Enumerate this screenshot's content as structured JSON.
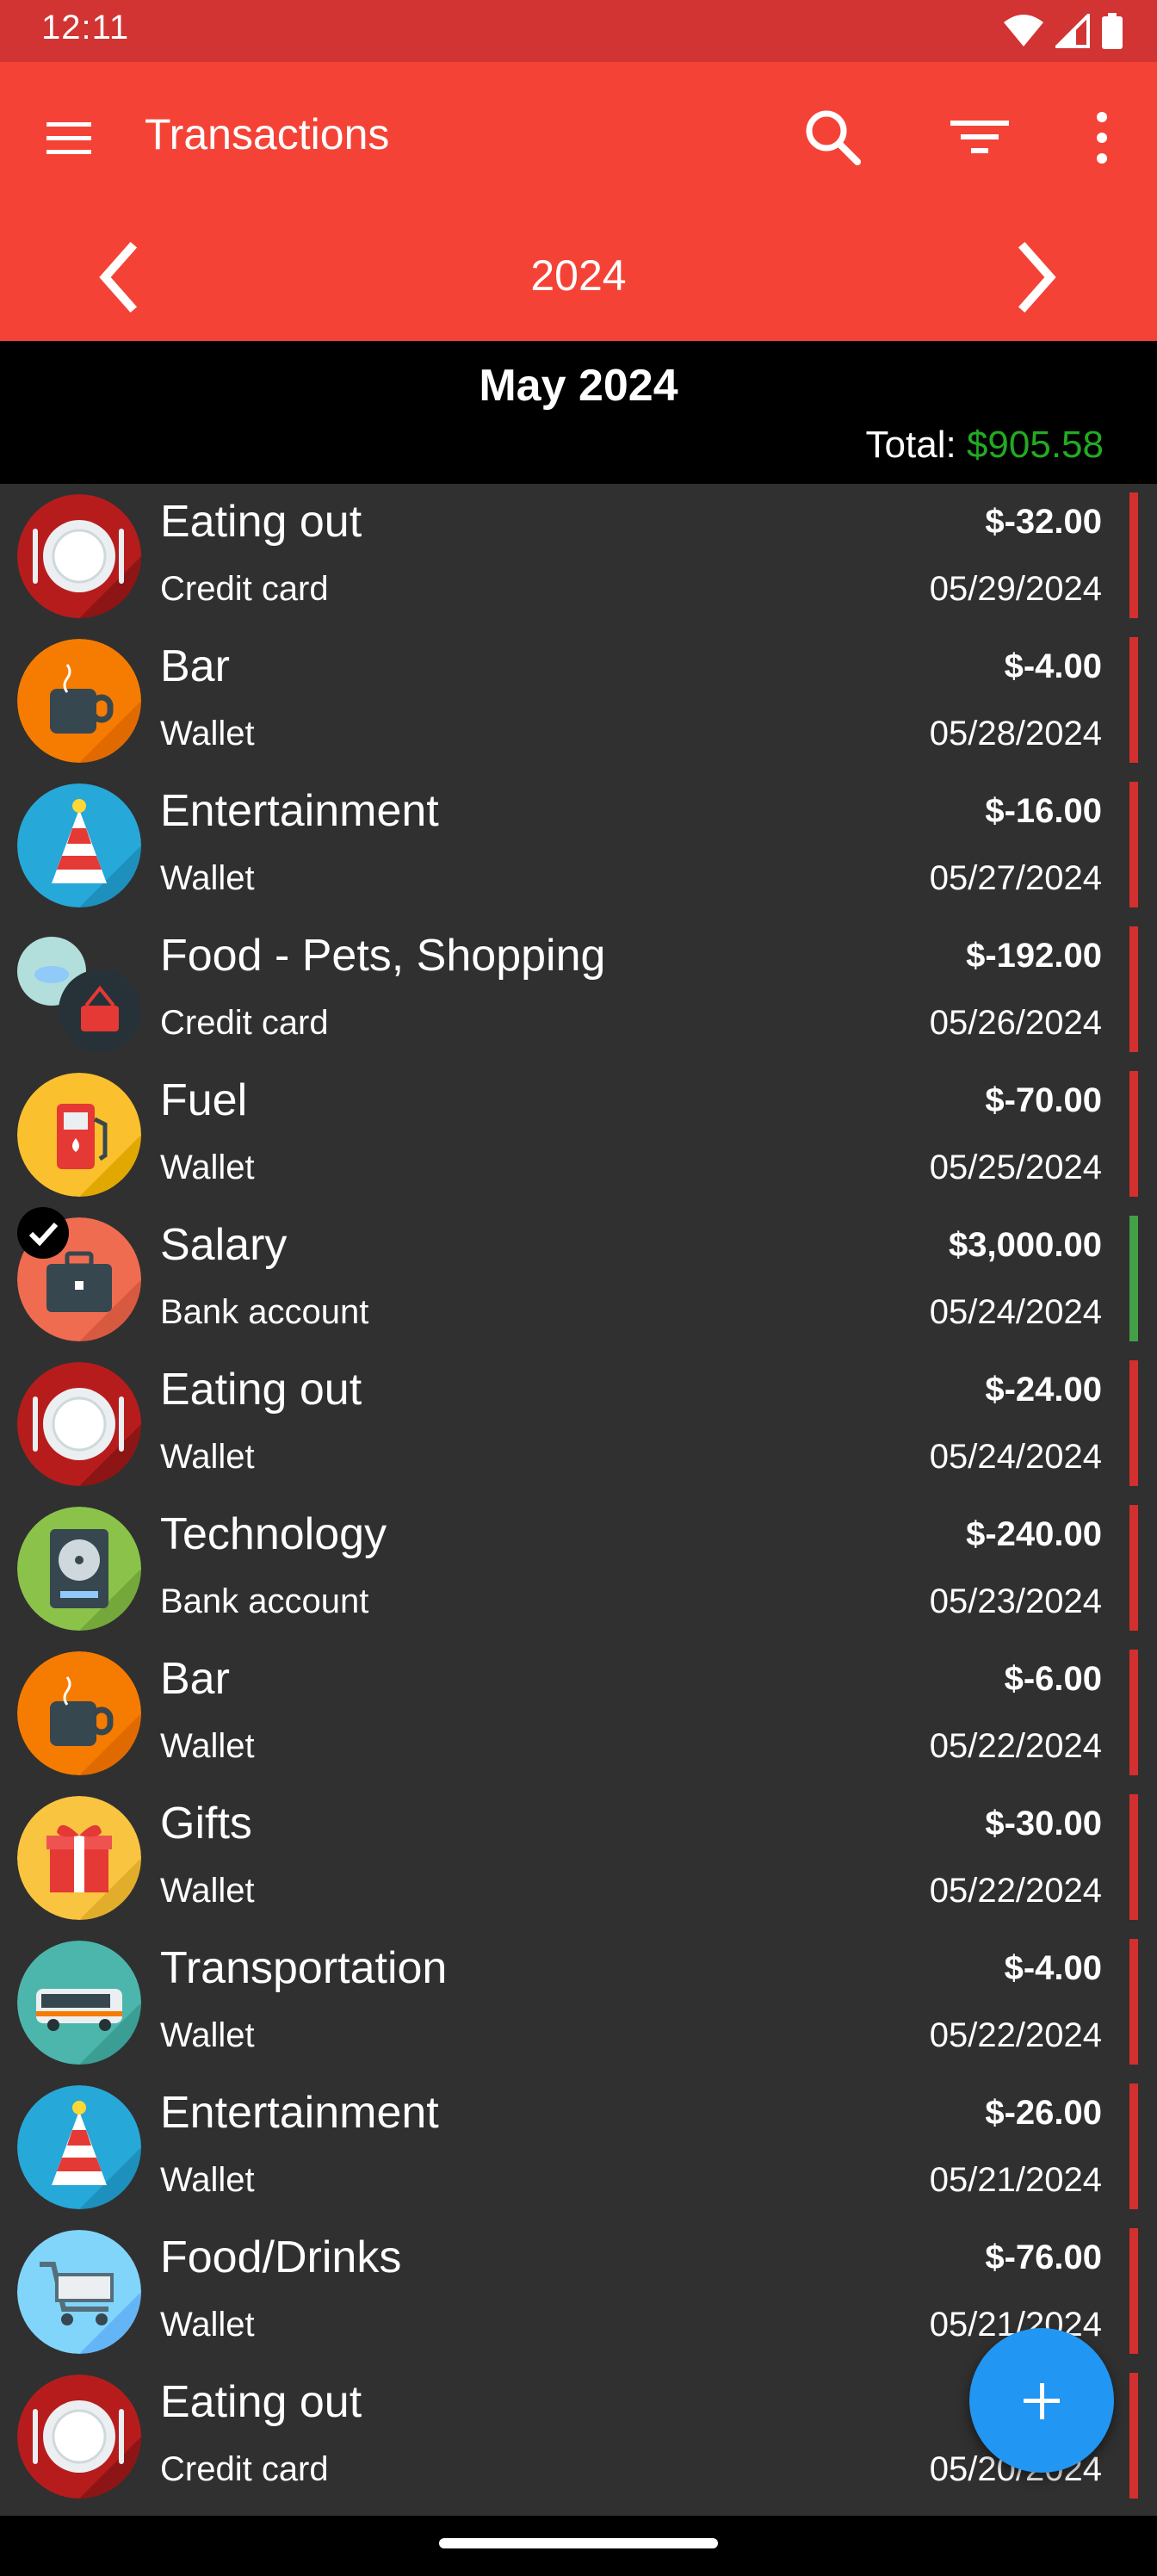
{
  "status": {
    "time": "12:11"
  },
  "toolbar": {
    "title": "Transactions",
    "year": "2024"
  },
  "month": {
    "title": "May 2024",
    "total_label": "Total:",
    "total_value": "$905.58",
    "total_color": "#22aa22"
  },
  "colors": {
    "expense": "#d32f2f",
    "income": "#43a047",
    "fab": "#2196f3",
    "toolbar": "#f44336"
  },
  "transactions": [
    {
      "category": "Eating out",
      "account": "Credit card",
      "amount": "$-32.00",
      "date": "05/29/2024",
      "type": "expense",
      "icon": "plate-icon"
    },
    {
      "category": "Bar",
      "account": "Wallet",
      "amount": "$-4.00",
      "date": "05/28/2024",
      "type": "expense",
      "icon": "coffee-cup-icon"
    },
    {
      "category": "Entertainment",
      "account": "Wallet",
      "amount": "$-16.00",
      "date": "05/27/2024",
      "type": "expense",
      "icon": "party-hat-icon"
    },
    {
      "category": "Food - Pets, Shopping",
      "account": "Credit card",
      "amount": "$-192.00",
      "date": "05/26/2024",
      "type": "expense",
      "icon": "pet-bowl-basket-icon"
    },
    {
      "category": "Fuel",
      "account": "Wallet",
      "amount": "$-70.00",
      "date": "05/25/2024",
      "type": "expense",
      "icon": "fuel-pump-icon"
    },
    {
      "category": "Salary",
      "account": "Bank account",
      "amount": "$3,000.00",
      "date": "05/24/2024",
      "type": "income",
      "icon": "briefcase-icon"
    },
    {
      "category": "Eating out",
      "account": "Wallet",
      "amount": "$-24.00",
      "date": "05/24/2024",
      "type": "expense",
      "icon": "plate-icon"
    },
    {
      "category": "Technology",
      "account": "Bank account",
      "amount": "$-240.00",
      "date": "05/23/2024",
      "type": "expense",
      "icon": "hard-drive-icon"
    },
    {
      "category": "Bar",
      "account": "Wallet",
      "amount": "$-6.00",
      "date": "05/22/2024",
      "type": "expense",
      "icon": "coffee-cup-icon"
    },
    {
      "category": "Gifts",
      "account": "Wallet",
      "amount": "$-30.00",
      "date": "05/22/2024",
      "type": "expense",
      "icon": "gift-icon"
    },
    {
      "category": "Transportation",
      "account": "Wallet",
      "amount": "$-4.00",
      "date": "05/22/2024",
      "type": "expense",
      "icon": "bus-icon"
    },
    {
      "category": "Entertainment",
      "account": "Wallet",
      "amount": "$-26.00",
      "date": "05/21/2024",
      "type": "expense",
      "icon": "party-hat-icon"
    },
    {
      "category": "Food/Drinks",
      "account": "Wallet",
      "amount": "$-76.00",
      "date": "05/21/2024",
      "type": "expense",
      "icon": "shopping-cart-icon"
    },
    {
      "category": "Eating out",
      "account": "Credit card",
      "amount": "",
      "date": "05/20/2024",
      "type": "expense",
      "icon": "plate-icon"
    }
  ]
}
